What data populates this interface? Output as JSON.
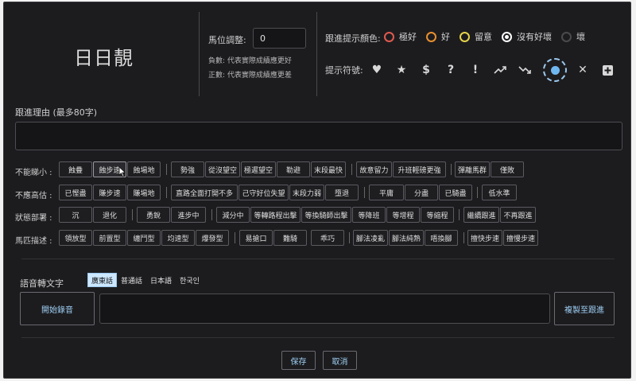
{
  "horse_name": "日日靚",
  "position": {
    "label": "馬位調整:",
    "value": "0",
    "note_negative": "負數: 代表實際成績應更好",
    "note_positive": "正數: 代表實際成績應更差"
  },
  "colors": {
    "label": "跟進提示顏色:",
    "options": [
      {
        "name": "極好",
        "color": "#e05a4e"
      },
      {
        "name": "好",
        "color": "#e8902e"
      },
      {
        "name": "留意",
        "color": "#e6d34a"
      },
      {
        "name": "沒有好壞",
        "color": "#ffffff"
      },
      {
        "name": "壞",
        "color": "#555555"
      }
    ],
    "selected": "沒有好壞"
  },
  "symbols": {
    "label": "提示符號:",
    "items": [
      "heart-icon",
      "star-icon",
      "dollar-icon",
      "question-icon",
      "exclamation-icon",
      "trend-up-icon",
      "trend-down-icon",
      "dot-icon",
      "close-icon",
      "plus-square-icon"
    ],
    "selected": "dot-icon"
  },
  "reason": {
    "label": "跟進理由 (最多80字)",
    "value": ""
  },
  "tag_rows": [
    {
      "label": "不能睇小 :",
      "groups": [
        [
          "蝕疊",
          "蝕步速",
          "蝕場地"
        ],
        [
          "勢強",
          "從沒望空",
          "極遲望空",
          "勒避",
          "末段最快"
        ],
        [
          "故意留力",
          "升班輕磅更強"
        ],
        [
          "彈離馬群",
          "僅敗"
        ]
      ]
    },
    {
      "label": "不應高估 :",
      "groups": [
        [
          "已慳盡",
          "賺步速",
          "賺場地"
        ],
        [
          "直路全面打開不多",
          "己守好位失望",
          "末段力弱",
          "墮退"
        ],
        [
          "平庸",
          "分盡",
          "已騎盡"
        ],
        [
          "低水準"
        ]
      ]
    },
    {
      "label": "狀態部署 :",
      "groups": [
        [
          "沉",
          "退化"
        ],
        [
          "勇銳",
          "進步中"
        ],
        [
          "減分中",
          "等轉路程出擊",
          "等換騎師出擊",
          "等降班",
          "等增程",
          "等縮程"
        ],
        [
          "繼續跟進",
          "不再跟進"
        ]
      ]
    },
    {
      "label": "馬匹描述 :",
      "groups": [
        [
          "領放型",
          "前置型",
          "纏鬥型",
          "均速型",
          "爆發型"
        ],
        [
          "易搶口",
          "難騎",
          "乖巧"
        ],
        [
          "腳法凌亂",
          "腳法純熟",
          "唔換腳"
        ],
        [
          "擅快步速",
          "擅慢步速"
        ]
      ]
    }
  ],
  "speech": {
    "label": "語音轉文字",
    "languages": [
      "廣東話",
      "普通話",
      "日本語",
      "한국인"
    ],
    "selected": "廣東話",
    "start_button": "開始錄音",
    "transcript": "",
    "copy_button": "複製至跟進"
  },
  "footer": {
    "save": "保存",
    "cancel": "取消"
  }
}
